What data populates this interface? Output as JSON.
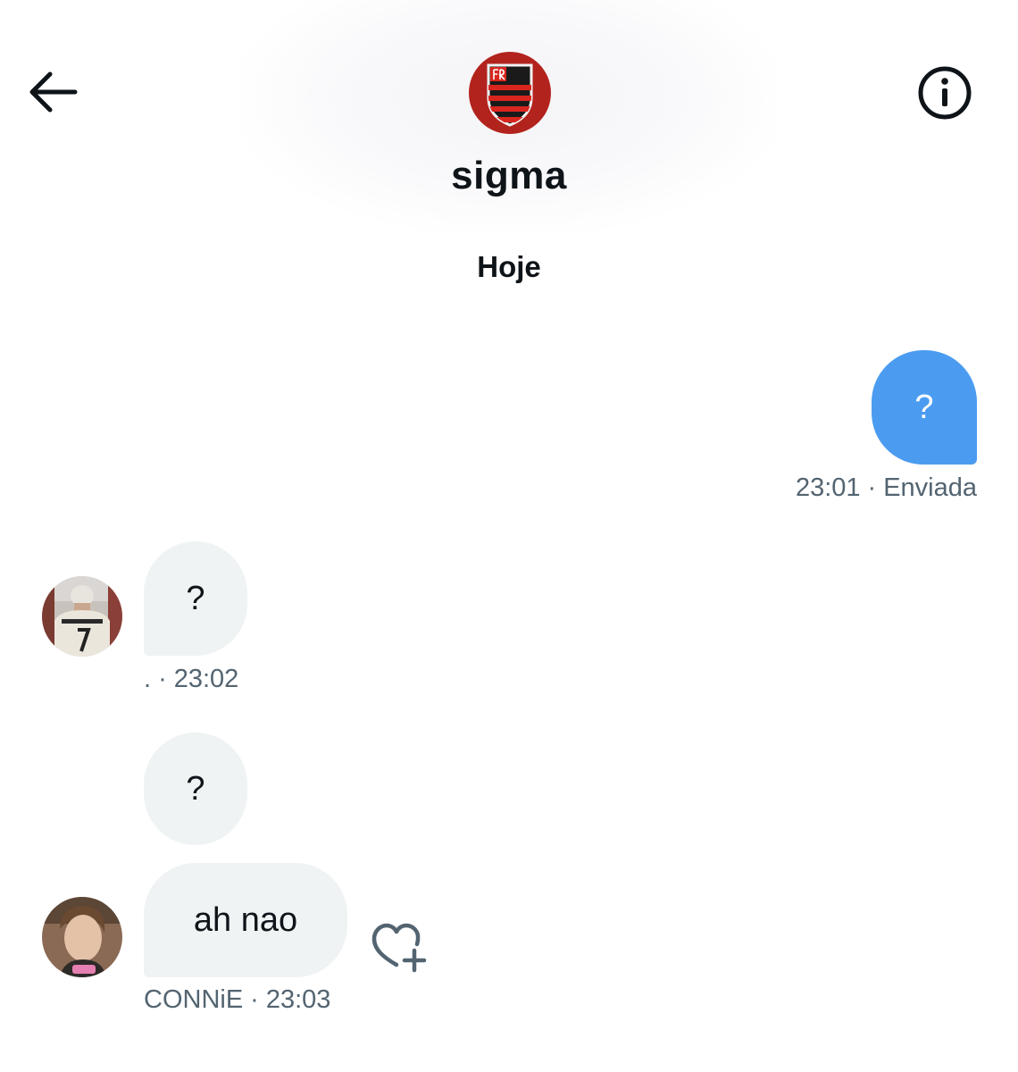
{
  "header": {
    "conversation_name": "sigma",
    "back_icon": "arrow-left-icon",
    "info_icon": "info-circle-icon",
    "avatar_icon": "flamengo-crest-icon"
  },
  "date_separator": "Hoje",
  "messages": [
    {
      "direction": "sent",
      "text": "?",
      "time": "23:01",
      "status": "Enviada"
    },
    {
      "direction": "received",
      "text": "?",
      "sender": ".",
      "time": "23:02"
    },
    {
      "direction": "received",
      "text": "?"
    },
    {
      "direction": "received",
      "text": "ah nao",
      "sender": "CONNiE",
      "time": "23:03"
    }
  ],
  "meta_separator": "·",
  "reaction_icon": "heart-plus-icon",
  "colors": {
    "sent_bubble": "#4b9cf0",
    "received_bubble": "#eff3f4",
    "meta_text": "#536471",
    "crest_red": "#b3231d"
  }
}
